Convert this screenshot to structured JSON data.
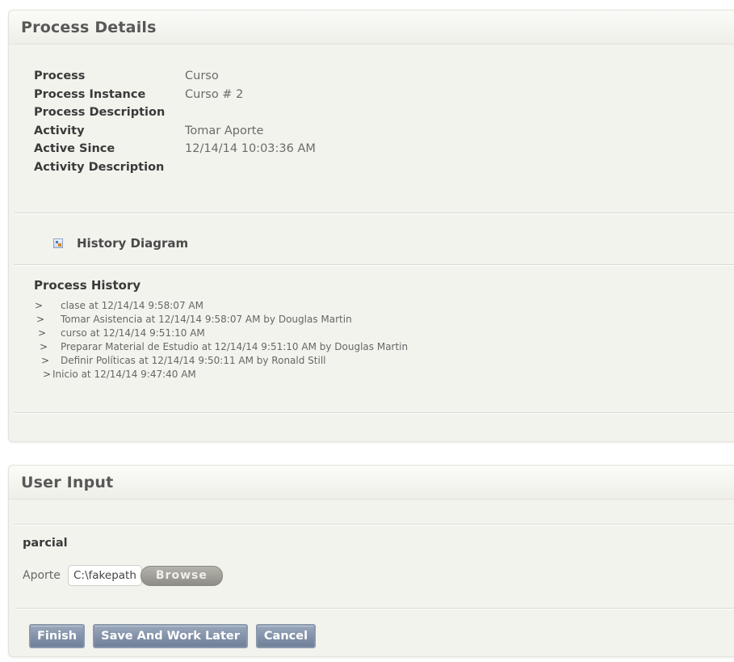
{
  "process_details": {
    "title": "Process Details",
    "fields": [
      {
        "label": "Process",
        "value": "Curso"
      },
      {
        "label": "Process Instance",
        "value": "Curso # 2"
      },
      {
        "label": "Process Description",
        "value": ""
      },
      {
        "label": "Activity",
        "value": "Tomar Aporte"
      },
      {
        "label": "Active Since",
        "value": "12/14/14 10:03:36 AM"
      },
      {
        "label": "Activity Description",
        "value": ""
      }
    ],
    "history_diagram_label": "History Diagram",
    "history_diagram_icon": "diagram-icon",
    "process_history": {
      "title": "Process History",
      "items": [
        {
          "marker": ">",
          "text": "clase at 12/14/14 9:58:07 AM"
        },
        {
          "marker": ">",
          "text": "Tomar Asistencia at 12/14/14 9:58:07 AM by Douglas Martin"
        },
        {
          "marker": ">",
          "text": "curso at 12/14/14 9:51:10 AM"
        },
        {
          "marker": ">",
          "text": "Preparar Material de Estudio at 12/14/14 9:51:10 AM by Douglas Martin"
        },
        {
          "marker": ">",
          "text": "Definir Políticas at 12/14/14 9:50:11 AM by Ronald Still"
        },
        {
          "marker": ">",
          "text": "Inicio at 12/14/14 9:47:40 AM"
        }
      ]
    }
  },
  "user_input": {
    "title": "User Input",
    "section": "parcial",
    "aporte_label": "Aporte",
    "file_value": "C:\\fakepath",
    "browse_label": "Browse",
    "buttons": {
      "finish": "Finish",
      "save_later": "Save And Work Later",
      "cancel": "Cancel"
    }
  },
  "colors": {
    "panel_bg": "#f3f3ee",
    "button_blue": "#7d8da5",
    "browse_gray": "#a0a098"
  }
}
